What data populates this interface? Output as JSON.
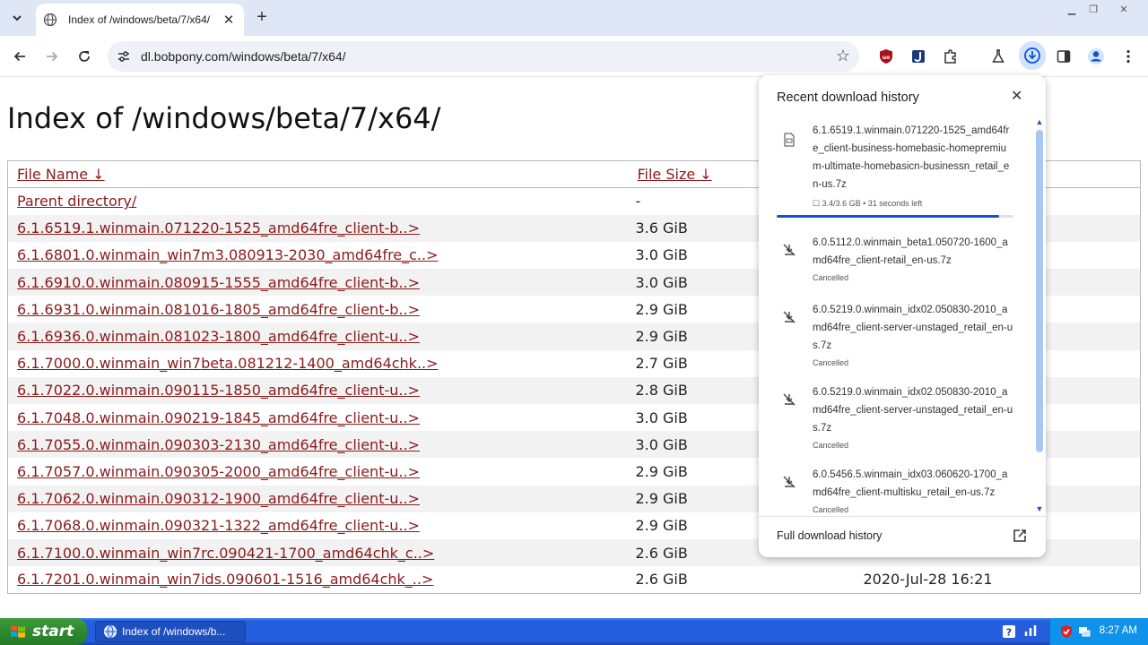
{
  "browser": {
    "tab": {
      "title": "Index of /windows/beta/7/x64/"
    },
    "url": "dl.bobpony.com/windows/beta/7/x64/"
  },
  "page": {
    "heading": "Index of /windows/beta/7/x64/",
    "table": {
      "headers": {
        "name": "File Name  ↓",
        "size": "File Size  ↓"
      },
      "rows": [
        {
          "name": "Parent directory/",
          "size": "-",
          "date": ""
        },
        {
          "name": "6.1.6519.1.winmain.071220-1525_amd64fre_client-b..>",
          "size": "3.6 GiB",
          "date": ""
        },
        {
          "name": "6.1.6801.0.winmain_win7m3.080913-2030_amd64fre_c..>",
          "size": "3.0 GiB",
          "date": ""
        },
        {
          "name": "6.1.6910.0.winmain.080915-1555_amd64fre_client-b..>",
          "size": "3.0 GiB",
          "date": ""
        },
        {
          "name": "6.1.6931.0.winmain.081016-1805_amd64fre_client-b..>",
          "size": "2.9 GiB",
          "date": ""
        },
        {
          "name": "6.1.6936.0.winmain.081023-1800_amd64fre_client-u..>",
          "size": "2.9 GiB",
          "date": ""
        },
        {
          "name": "6.1.7000.0.winmain_win7beta.081212-1400_amd64chk..>",
          "size": "2.7 GiB",
          "date": ""
        },
        {
          "name": "6.1.7022.0.winmain.090115-1850_amd64fre_client-u..>",
          "size": "2.8 GiB",
          "date": ""
        },
        {
          "name": "6.1.7048.0.winmain.090219-1845_amd64fre_client-u..>",
          "size": "3.0 GiB",
          "date": ""
        },
        {
          "name": "6.1.7055.0.winmain.090303-2130_amd64fre_client-u..>",
          "size": "3.0 GiB",
          "date": ""
        },
        {
          "name": "6.1.7057.0.winmain.090305-2000_amd64fre_client-u..>",
          "size": "2.9 GiB",
          "date": ""
        },
        {
          "name": "6.1.7062.0.winmain.090312-1900_amd64fre_client-u..>",
          "size": "2.9 GiB",
          "date": ""
        },
        {
          "name": "6.1.7068.0.winmain.090321-1322_amd64fre_client-u..>",
          "size": "2.9 GiB",
          "date": ""
        },
        {
          "name": "6.1.7100.0.winmain_win7rc.090421-1700_amd64chk_c..>",
          "size": "2.6 GiB",
          "date": ""
        },
        {
          "name": "6.1.7201.0.winmain_win7ids.090601-1516_amd64chk_..>",
          "size": "2.6 GiB",
          "date": "2020-Jul-28 16:21"
        }
      ]
    }
  },
  "downloads": {
    "title": "Recent download history",
    "items": [
      {
        "filename": "6.1.6519.1.winmain.071220-1525_amd64fre_client-business-homebasic-homepremium-ultimate-homebasicn-businessn_retail_en-us.7z",
        "status": "☐ 3.4/3.6 GB • 31 seconds left",
        "progress": 0.94
      },
      {
        "filename": "6.0.5112.0.winmain_beta1.050720-1600_amd64fre_client-retail_en-us.7z",
        "status": "Cancelled"
      },
      {
        "filename": "6.0.5219.0.winmain_idx02.050830-2010_amd64fre_client-server-unstaged_retail_en-us.7z",
        "status": "Cancelled"
      },
      {
        "filename": "6.0.5219.0.winmain_idx02.050830-2010_amd64fre_client-server-unstaged_retail_en-us.7z",
        "status": "Cancelled"
      },
      {
        "filename": "6.0.5456.5.winmain_idx03.060620-1700_amd64fre_client-multisku_retail_en-us.7z",
        "status": "Cancelled"
      }
    ],
    "footer": "Full download history"
  },
  "taskbar": {
    "start": "start",
    "item": "Index of /windows/b...",
    "clock": "8:27 AM"
  },
  "colors": {
    "link": "#8a1b1b",
    "accent": "#0b57d0",
    "taskbar": "#245edc",
    "start": "#2f8a2f"
  },
  "icons": [
    "chevron-down-icon",
    "globe-icon",
    "close-icon",
    "plus-icon",
    "back-icon",
    "forward-icon",
    "reload-icon",
    "site-info-icon",
    "star-icon",
    "ublock-icon",
    "extension-icon",
    "puzzle-icon",
    "labs-icon",
    "download-icon",
    "sidepanel-icon",
    "profile-icon",
    "menu-icon",
    "file-icon",
    "cancelled-download-icon",
    "open-external-icon",
    "windows-flag-icon",
    "help-icon",
    "shield-icon"
  ]
}
